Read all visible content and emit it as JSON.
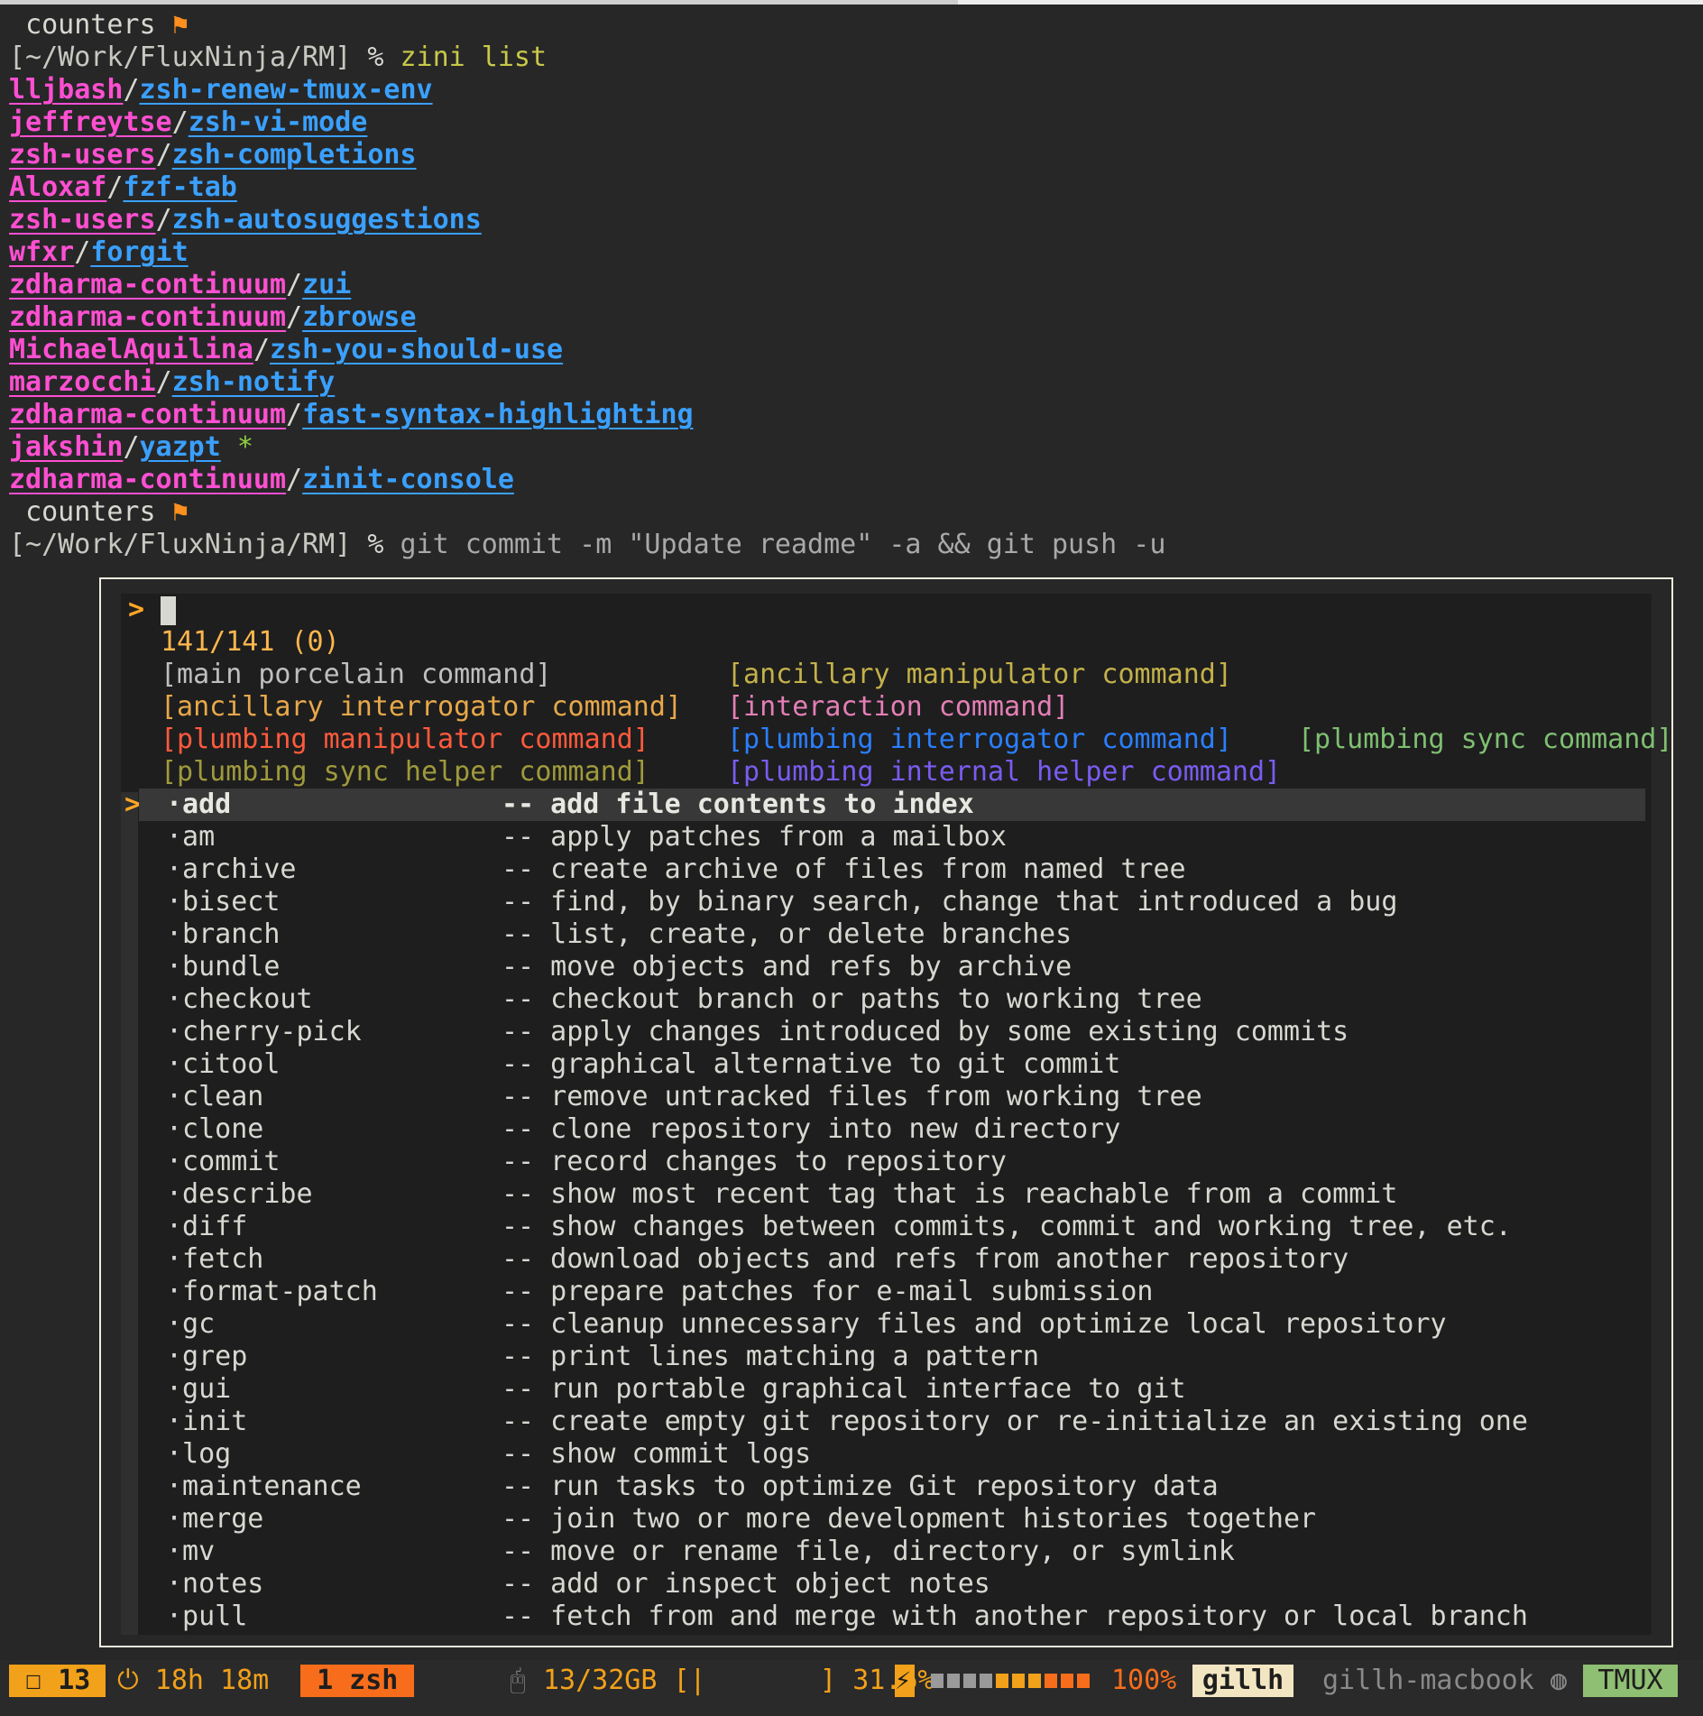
{
  "prompt": {
    "host": "counters",
    "flag": "⚑",
    "path": "[~/Work/FluxNinja/RM]",
    "sym": "%"
  },
  "cmd1": "zini list",
  "plugins": [
    {
      "user": "lljbash",
      "repo": "zsh-renew-tmux-env",
      "star": ""
    },
    {
      "user": "jeffreytse",
      "repo": "zsh-vi-mode",
      "star": ""
    },
    {
      "user": "zsh-users",
      "repo": "zsh-completions",
      "star": ""
    },
    {
      "user": "Aloxaf",
      "repo": "fzf-tab",
      "star": ""
    },
    {
      "user": "zsh-users",
      "repo": "zsh-autosuggestions",
      "star": ""
    },
    {
      "user": "wfxr",
      "repo": "forgit",
      "star": ""
    },
    {
      "user": "zdharma-continuum",
      "repo": "zui",
      "star": ""
    },
    {
      "user": "zdharma-continuum",
      "repo": "zbrowse",
      "star": ""
    },
    {
      "user": "MichaelAquilina",
      "repo": "zsh-you-should-use",
      "star": ""
    },
    {
      "user": "marzocchi",
      "repo": "zsh-notify",
      "star": ""
    },
    {
      "user": "zdharma-continuum",
      "repo": "fast-syntax-highlighting",
      "star": ""
    },
    {
      "user": "jakshin",
      "repo": "yazpt",
      "star": " *"
    },
    {
      "user": "zdharma-continuum",
      "repo": "zinit-console",
      "star": ""
    }
  ],
  "cmd2": "git commit -m \"Update readme\" -a && git push -u",
  "popup": {
    "prompt_symbol": ">",
    "count": "141/141 (0)",
    "groups": {
      "main": "[main porcelain command]",
      "anc_man": "[ancillary manipulator command]",
      "anc_int": "[ancillary interrogator command]",
      "inter": "[interaction command]",
      "plm_man": "[plumbing manipulator command]",
      "plm_int": "[plumbing interrogator command]",
      "plm_sync": "[plumbing sync command]",
      "sync_help": "[plumbing sync helper command]",
      "internal": "[plumbing internal helper command]"
    },
    "selected_marker": ">",
    "commands": [
      {
        "name": "·add",
        "desc": "-- add file contents to index"
      },
      {
        "name": "·am",
        "desc": "-- apply patches from a mailbox"
      },
      {
        "name": "·archive",
        "desc": "-- create archive of files from named tree"
      },
      {
        "name": "·bisect",
        "desc": "-- find, by binary search, change that introduced a bug"
      },
      {
        "name": "·branch",
        "desc": "-- list, create, or delete branches"
      },
      {
        "name": "·bundle",
        "desc": "-- move objects and refs by archive"
      },
      {
        "name": "·checkout",
        "desc": "-- checkout branch or paths to working tree"
      },
      {
        "name": "·cherry-pick",
        "desc": "-- apply changes introduced by some existing commits"
      },
      {
        "name": "·citool",
        "desc": "-- graphical alternative to git commit"
      },
      {
        "name": "·clean",
        "desc": "-- remove untracked files from working tree"
      },
      {
        "name": "·clone",
        "desc": "-- clone repository into new directory"
      },
      {
        "name": "·commit",
        "desc": "-- record changes to repository"
      },
      {
        "name": "·describe",
        "desc": "-- show most recent tag that is reachable from a commit"
      },
      {
        "name": "·diff",
        "desc": "-- show changes between commits, commit and working tree, etc."
      },
      {
        "name": "·fetch",
        "desc": "-- download objects and refs from another repository"
      },
      {
        "name": "·format-patch",
        "desc": "-- prepare patches for e-mail submission"
      },
      {
        "name": "·gc",
        "desc": "-- cleanup unnecessary files and optimize local repository"
      },
      {
        "name": "·grep",
        "desc": "-- print lines matching a pattern"
      },
      {
        "name": "·gui",
        "desc": "-- run portable graphical interface to git"
      },
      {
        "name": "·init",
        "desc": "-- create empty git repository or re-initialize an existing one"
      },
      {
        "name": "·log",
        "desc": "-- show commit logs"
      },
      {
        "name": "·maintenance",
        "desc": "-- run tasks to optimize Git repository data"
      },
      {
        "name": "·merge",
        "desc": "-- join two or more development histories together"
      },
      {
        "name": "·mv",
        "desc": "-- move or rename file, directory, or symlink"
      },
      {
        "name": "·notes",
        "desc": "-- add or inspect object notes"
      },
      {
        "name": "·pull",
        "desc": "-- fetch from and merge with another repository or local branch"
      }
    ]
  },
  "status": {
    "windows_icon": "☐",
    "windows_count": "13",
    "uptime_icon": "⏻",
    "uptime": "18h 18m",
    "active_window": "1 zsh",
    "mem_icon": "🖰",
    "mem": "13/32GB",
    "mem_bar": "[|       ]",
    "cpu": "31.6%",
    "battery_icon": "⚡",
    "battery_pct": "100%",
    "user": "gillh",
    "hostname": "gillh-macbook",
    "host_icon": "◍",
    "tmux": "TMUX",
    "battery_level": 1.0
  },
  "colors": {
    "accent_orange": "#ff8f1f",
    "user_pink": "#ff4fd2",
    "repo_blue": "#3aa0ff",
    "status_green": "#8fbf72"
  }
}
